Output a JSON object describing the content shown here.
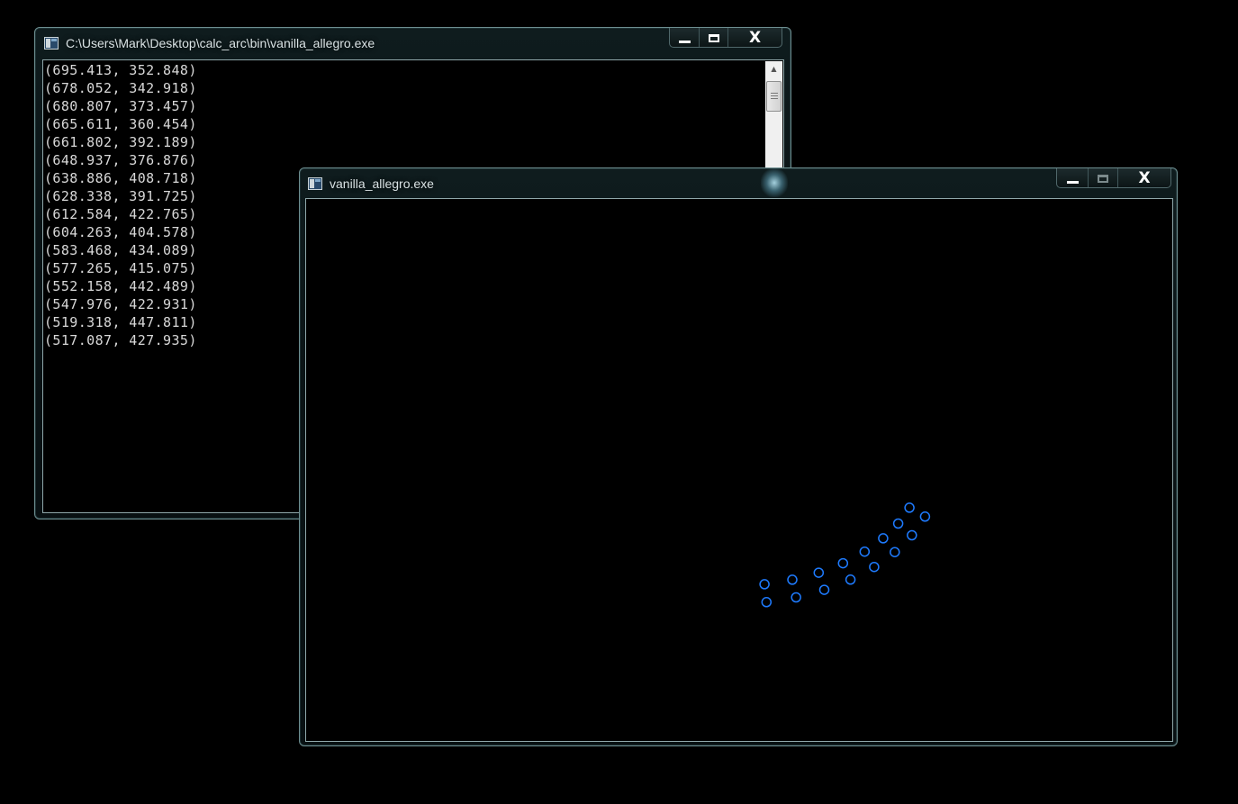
{
  "console_window": {
    "title": "C:\\Users\\Mark\\Desktop\\calc_arc\\bin\\vanilla_allegro.exe",
    "lines": [
      "(695.413, 352.848)",
      "(678.052, 342.918)",
      "(680.807, 373.457)",
      "(665.611, 360.454)",
      "(661.802, 392.189)",
      "(648.937, 376.876)",
      "(638.886, 408.718)",
      "(628.338, 391.725)",
      "(612.584, 422.765)",
      "(604.263, 404.578)",
      "(583.468, 434.089)",
      "(577.265, 415.075)",
      "(552.158, 442.489)",
      "(547.976, 422.931)",
      "(519.318, 447.811)",
      "(517.087, 427.935)"
    ],
    "minimize_icon": "minimize-icon",
    "maximize_icon": "maximize-icon",
    "close_label": "X"
  },
  "allegro_window": {
    "title": "vanilla_allegro.exe",
    "close_label": "X",
    "circle_color": "#1e7bff",
    "points": [
      [
        695.413,
        352.848
      ],
      [
        678.052,
        342.918
      ],
      [
        680.807,
        373.457
      ],
      [
        665.611,
        360.454
      ],
      [
        661.802,
        392.189
      ],
      [
        648.937,
        376.876
      ],
      [
        638.886,
        408.718
      ],
      [
        628.338,
        391.725
      ],
      [
        612.584,
        422.765
      ],
      [
        604.263,
        404.578
      ],
      [
        583.468,
        434.089
      ],
      [
        577.265,
        415.075
      ],
      [
        552.158,
        442.489
      ],
      [
        547.976,
        422.931
      ],
      [
        519.318,
        447.811
      ],
      [
        517.087,
        427.935
      ]
    ]
  }
}
